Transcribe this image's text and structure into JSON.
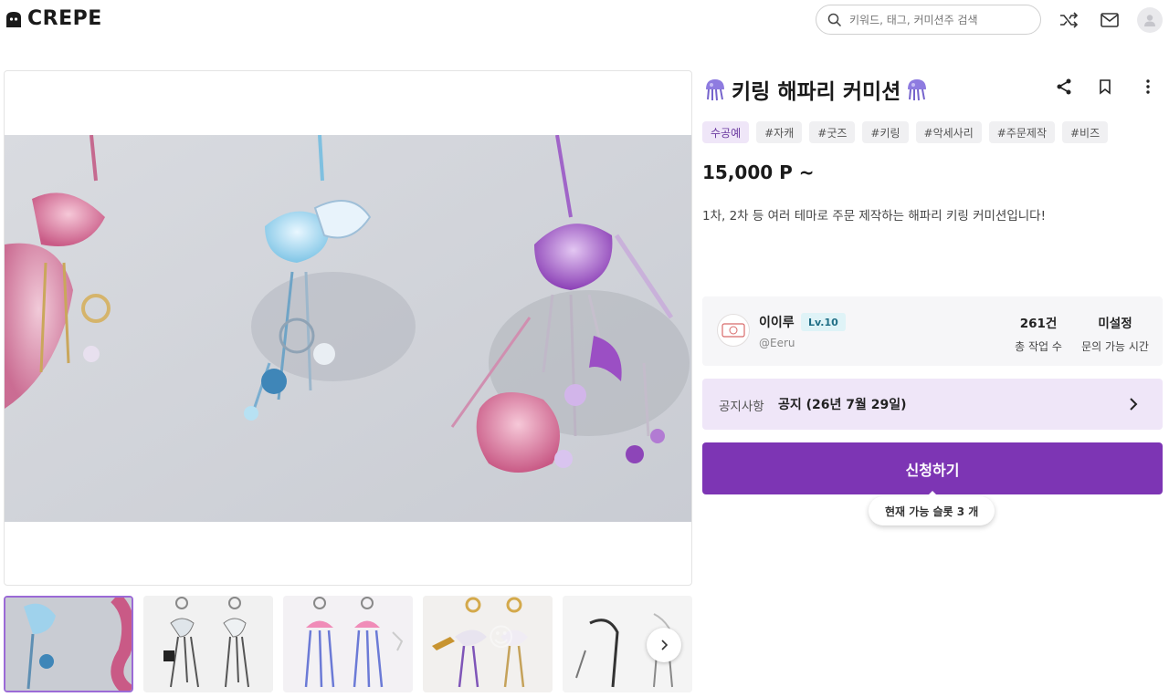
{
  "header": {
    "logo_text": "CREPE",
    "search": {
      "placeholder": "키워드, 태그, 커미션주 검색"
    },
    "icons": [
      "shuffle-icon",
      "mail-icon",
      "user-avatar-icon"
    ]
  },
  "gallery": {
    "main_image_alt": "jellyfish keyring photo",
    "thumbnail_count": 5,
    "active_thumbnail": 1,
    "next_icon": "chevron-right-icon"
  },
  "product": {
    "title": "키링 해파리 커미션",
    "title_emoji": "jellyfish-icon",
    "actions": [
      "share-icon",
      "bookmark-icon",
      "more-vertical-icon"
    ],
    "tags": [
      "수공예",
      "#자캐",
      "#굿즈",
      "#키링",
      "#악세사리",
      "#주문제작",
      "#비즈"
    ],
    "price": "15,000 P ~",
    "description": "1차, 2차 등 여러 테마로 주문 제작하는 해파리 키링 커미션입니다!"
  },
  "creator": {
    "name": "이이루",
    "level": "Lv.10",
    "handle": "@Eeru",
    "stats": [
      {
        "value": "261건",
        "label": "총 작업 수"
      },
      {
        "value": "미설정",
        "label": "문의 가능 시간"
      }
    ]
  },
  "notice": {
    "label": "공지사항",
    "text": "공지 (26년 7월 29일)"
  },
  "apply": {
    "button_label": "신청하기",
    "slot_text": "현재 가능 슬롯 3 개"
  },
  "colors": {
    "accent": "#7d35b4",
    "accent_light": "#efe6f8",
    "level_badge": "#dff3f7"
  }
}
